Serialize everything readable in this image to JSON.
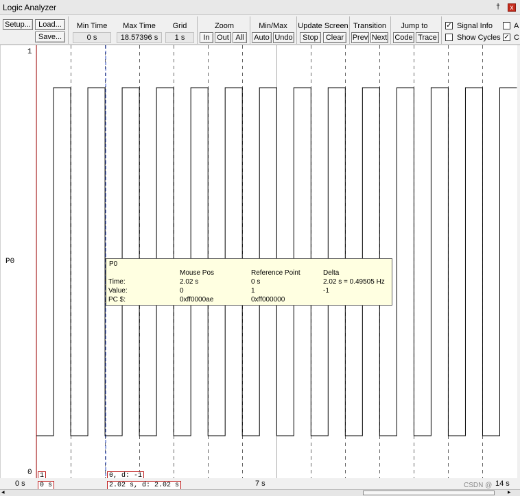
{
  "window": {
    "title": "Logic Analyzer",
    "pin_glyph": "†",
    "close_glyph": "x"
  },
  "toolbar": {
    "setup": "Setup...",
    "load": "Load...",
    "save": "Save...",
    "min_time": {
      "label": "Min Time",
      "value": "0 s"
    },
    "max_time": {
      "label": "Max Time",
      "value": "18.57396 s"
    },
    "grid": {
      "label": "Grid",
      "value": "1 s"
    },
    "zoom": {
      "label": "Zoom",
      "in": "In",
      "out": "Out",
      "all": "All"
    },
    "minmax": {
      "label": "Min/Max",
      "auto": "Auto",
      "undo": "Undo"
    },
    "update": {
      "label": "Update Screen",
      "stop": "Stop",
      "clear": "Clear"
    },
    "transition": {
      "label": "Transition",
      "prev": "Prev",
      "next": "Next"
    },
    "jump": {
      "label": "Jump to",
      "code": "Code",
      "trace": "Trace"
    },
    "signal_info": {
      "label": "Signal Info",
      "checked": true
    },
    "show_cycles": {
      "label": "Show Cycles",
      "checked": false
    },
    "extra_a": {
      "label": "A",
      "checked": false
    },
    "extra_c": {
      "label": "C",
      "checked": true
    }
  },
  "signal": {
    "name": "P0",
    "top_value": "1",
    "bottom_value": "0",
    "period_s": 1,
    "high_fraction": 0.5,
    "visible_start_s": 0,
    "visible_end_s": 14.0
  },
  "cursor": {
    "time_s": 2.02
  },
  "tooltip": {
    "signal": "P0",
    "headers": [
      "Mouse Pos",
      "Reference Point",
      "Delta"
    ],
    "rows": [
      {
        "label": "Time:",
        "mouse": "2.02 s",
        "ref": "0 s",
        "delta": "2.02 s = 0.49505 Hz"
      },
      {
        "label": "Value:",
        "mouse": "0",
        "ref": "1",
        "delta": "-1"
      },
      {
        "label": "PC $:",
        "mouse": "0xff0000ae",
        "ref": "0xff000000",
        "delta": ""
      }
    ]
  },
  "markers": {
    "ref_value": "1",
    "cursor_value": "0,   d: -1"
  },
  "timeline": {
    "left_time": "0 s",
    "ref_time": "0 s",
    "cursor_time": "2.02 s,   d: 2.02 s",
    "mid_time": "7 s",
    "right_time": "14 s",
    "watermark": "CSDN @"
  },
  "colors": {
    "ref_line": "#d03030",
    "cursor_line": "#2040c0",
    "trace": "#000000",
    "grid": "#555555"
  }
}
